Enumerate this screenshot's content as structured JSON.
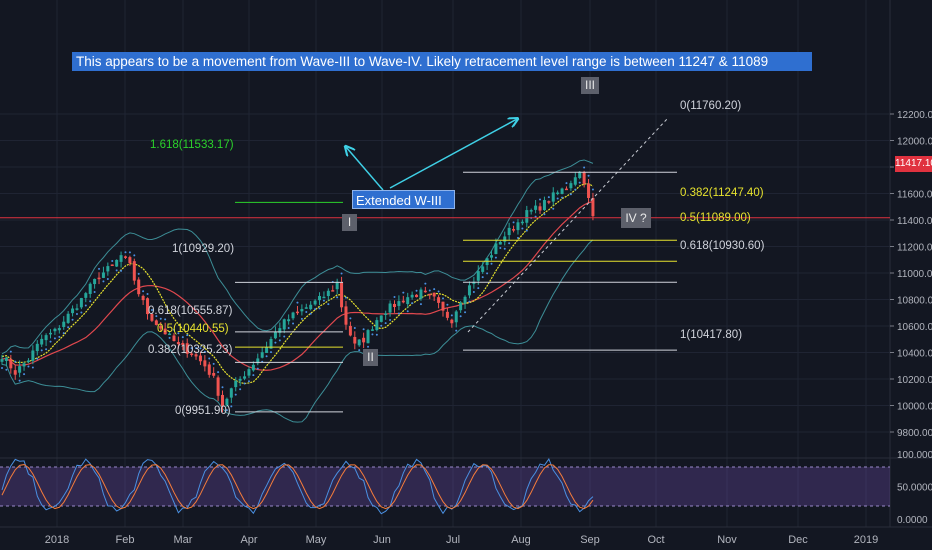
{
  "banner": "This appears to be a movement from Wave-III to Wave-IV. Likely retracement level range is between 11247 & 11089",
  "callout": "Extended W-III",
  "current_price": "11417.10",
  "wave_labels": {
    "w1": "I",
    "w2": "II",
    "w3": "III",
    "w4": "IV ?"
  },
  "fib_left": {
    "ext": "1.618(11533.17)",
    "top": "1(10929.20)",
    "f618": "0.618(10555.87)",
    "f5": "0.5(10440.55)",
    "f382": "0.382(10325.23)",
    "zero": "0(9951.90)"
  },
  "fib_right": {
    "zero": "0(11760.20)",
    "f382": "0.382(11247.40)",
    "f5": "0.5(11089.00)",
    "f618": "0.618(10930.60)",
    "one": "1(10417.80)"
  },
  "colors": {
    "background": "#131722",
    "up": "#26a69a",
    "down": "#ef5350",
    "fib_yellow": "#e6e22e",
    "fib_green": "#2bd22b",
    "fib_white": "#d1d4dc",
    "arrow": "#3fd0e6",
    "stoch_band": "#7e57c2"
  },
  "chart_data": {
    "type": "candlestick",
    "price_axis_ticks": [
      "12200.00",
      "12000.00",
      "11800.00",
      "11600.00",
      "11400.00",
      "11200.00",
      "11000.00",
      "10800.00",
      "10600.00",
      "10400.00",
      "10200.00",
      "10000.00",
      "9800.00"
    ],
    "oscillator_axis_ticks": [
      "100.0000",
      "50.0000",
      "0.0000"
    ],
    "time_axis_ticks": [
      "2018",
      "Feb",
      "Mar",
      "Apr",
      "May",
      "Jun",
      "Jul",
      "Aug",
      "Sep",
      "Oct",
      "Nov",
      "Dec",
      "2019"
    ],
    "ylim": [
      9700,
      12300
    ],
    "close_path": [
      [
        0,
        10380
      ],
      [
        3,
        10250
      ],
      [
        6,
        10350
      ],
      [
        9,
        10500
      ],
      [
        12,
        10560
      ],
      [
        15,
        10680
      ],
      [
        18,
        10800
      ],
      [
        19,
        10850
      ],
      [
        22,
        10980
      ],
      [
        25,
        11050
      ],
      [
        27,
        11130
      ],
      [
        29,
        11050
      ],
      [
        31,
        10850
      ],
      [
        33,
        10700
      ],
      [
        35,
        10620
      ],
      [
        37,
        10550
      ],
      [
        40,
        10450
      ],
      [
        43,
        10400
      ],
      [
        46,
        10300
      ],
      [
        48,
        10200
      ],
      [
        50,
        10000
      ],
      [
        52,
        10120
      ],
      [
        54,
        10200
      ],
      [
        57,
        10320
      ],
      [
        60,
        10450
      ],
      [
        63,
        10600
      ],
      [
        66,
        10680
      ],
      [
        69,
        10740
      ],
      [
        72,
        10800
      ],
      [
        75,
        10880
      ],
      [
        76,
        10929
      ],
      [
        77,
        10750
      ],
      [
        78,
        10620
      ],
      [
        80,
        10450
      ],
      [
        82,
        10500
      ],
      [
        84,
        10600
      ],
      [
        86,
        10700
      ],
      [
        89,
        10760
      ],
      [
        92,
        10820
      ],
      [
        95,
        10850
      ],
      [
        98,
        10800
      ],
      [
        100,
        10700
      ],
      [
        102,
        10650
      ],
      [
        104,
        10800
      ],
      [
        107,
        10950
      ],
      [
        110,
        11100
      ],
      [
        113,
        11250
      ],
      [
        116,
        11350
      ],
      [
        119,
        11450
      ],
      [
        122,
        11500
      ],
      [
        125,
        11580
      ],
      [
        128,
        11650
      ],
      [
        130,
        11740
      ],
      [
        131,
        11760
      ],
      [
        132,
        11700
      ],
      [
        133,
        11550
      ],
      [
        134,
        11417
      ]
    ],
    "stochastic_range": [
      20,
      80
    ],
    "fibonacci_retracement_1": {
      "levels": [
        [
          "1.618",
          11533.17
        ],
        [
          "1",
          10929.2
        ],
        [
          "0.618",
          10555.87
        ],
        [
          "0.5",
          10440.55
        ],
        [
          "0.382",
          10325.23
        ],
        [
          "0",
          9951.9
        ]
      ]
    },
    "fibonacci_retracement_2": {
      "levels": [
        [
          "0",
          11760.2
        ],
        [
          "0.382",
          11247.4
        ],
        [
          "0.5",
          11089.0
        ],
        [
          "0.618",
          10930.6
        ],
        [
          "1",
          10417.8
        ]
      ]
    },
    "last_price": 11417.1
  }
}
